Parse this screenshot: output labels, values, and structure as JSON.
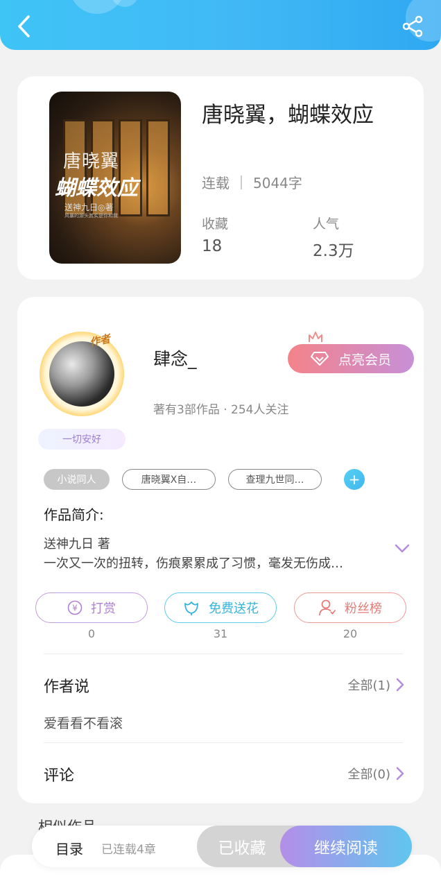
{
  "header": {
    "back_icon": "chevron-left-icon",
    "share_icon": "share-icon"
  },
  "book": {
    "cover": {
      "title_line1": "唐晓翼",
      "title_line2": "蝴蝶效应",
      "author_line": "送神九日◎著",
      "tagline": "风暴的源头其实是你和我"
    },
    "title": "唐晓翼，蝴蝶效应",
    "status": "连载",
    "word_count": "5044字",
    "favorites_label": "收藏",
    "favorites_value": "18",
    "popularity_label": "人气",
    "popularity_value": "2.3万"
  },
  "author": {
    "avatar_tag": "作者",
    "badge": "一切安好",
    "name": "肆念_",
    "stats": "著有3部作品 · 254人关注",
    "vip_button": "点亮会员"
  },
  "tags": [
    "小说同人",
    "唐晓翼X自…",
    "查理九世同…"
  ],
  "intro": {
    "title": "作品简介:",
    "line1": "送神九日 著",
    "line2": "一次又一次的扭转，伤痕累累成了习惯，毫发无伤成…"
  },
  "actions": [
    {
      "label": "打赏",
      "count": "0",
      "icon": "yen-coin-icon"
    },
    {
      "label": "免费送花",
      "count": "31",
      "icon": "flower-icon"
    },
    {
      "label": "粉丝榜",
      "count": "20",
      "icon": "user-rank-icon"
    }
  ],
  "author_says": {
    "title": "作者说",
    "link": "全部(1)",
    "text": "爱看看不看滚"
  },
  "comments": {
    "title": "评论",
    "link": "全部(0)"
  },
  "similar": {
    "title": "相似作品"
  },
  "bottom": {
    "toc_label": "目录",
    "chapters": "已连载4章",
    "collected_label": "已收藏",
    "read_label": "继续阅读"
  },
  "colors": {
    "header": "#41b8f5",
    "vip": "#f48389",
    "read_start": "#b48ee8",
    "read_end": "#5fc6ef"
  }
}
